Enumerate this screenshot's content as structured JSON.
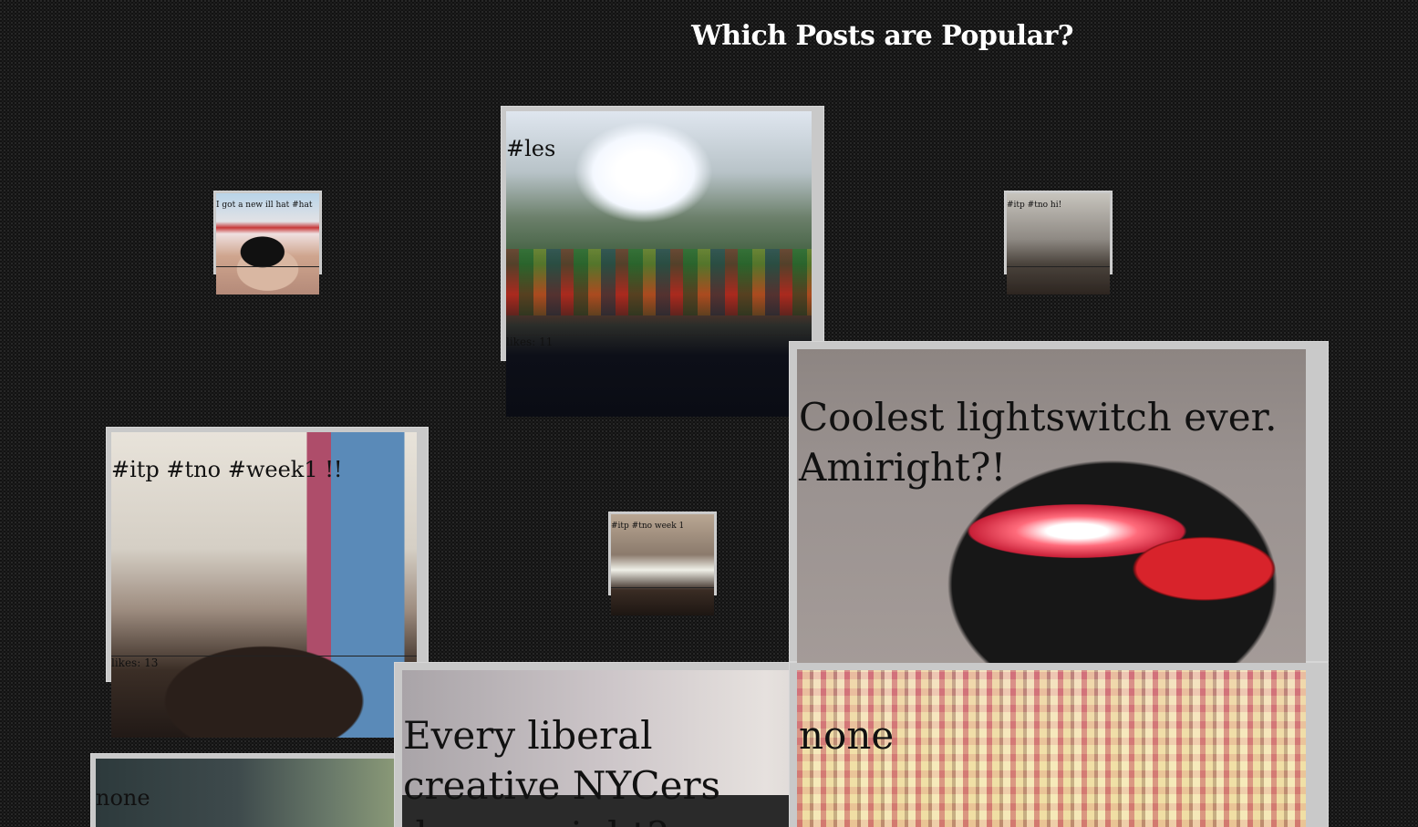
{
  "page": {
    "title": "Which Posts are Popular?"
  },
  "posts": {
    "hat": {
      "caption": "I got a new ill hat #hat"
    },
    "les": {
      "caption": "#les",
      "likes": "likes: 11"
    },
    "itp_hi": {
      "caption": "#itp #tno hi!"
    },
    "week1_large": {
      "caption": "#itp #tno #week1 !!",
      "likes": "likes: 13"
    },
    "week1_small": {
      "caption": "#itp #tno week 1"
    },
    "lightswitch": {
      "caption": "Coolest lightswitch ever. Amiright?!"
    },
    "liberal": {
      "caption": "Every liberal creative NYCers dream, right?"
    },
    "grid": {
      "caption": "none"
    },
    "bottom_left": {
      "caption": "none"
    }
  },
  "colors": {
    "background": "#121212",
    "frame": "#c9c9c9",
    "title": "#ffffff",
    "caption": "#111111"
  }
}
